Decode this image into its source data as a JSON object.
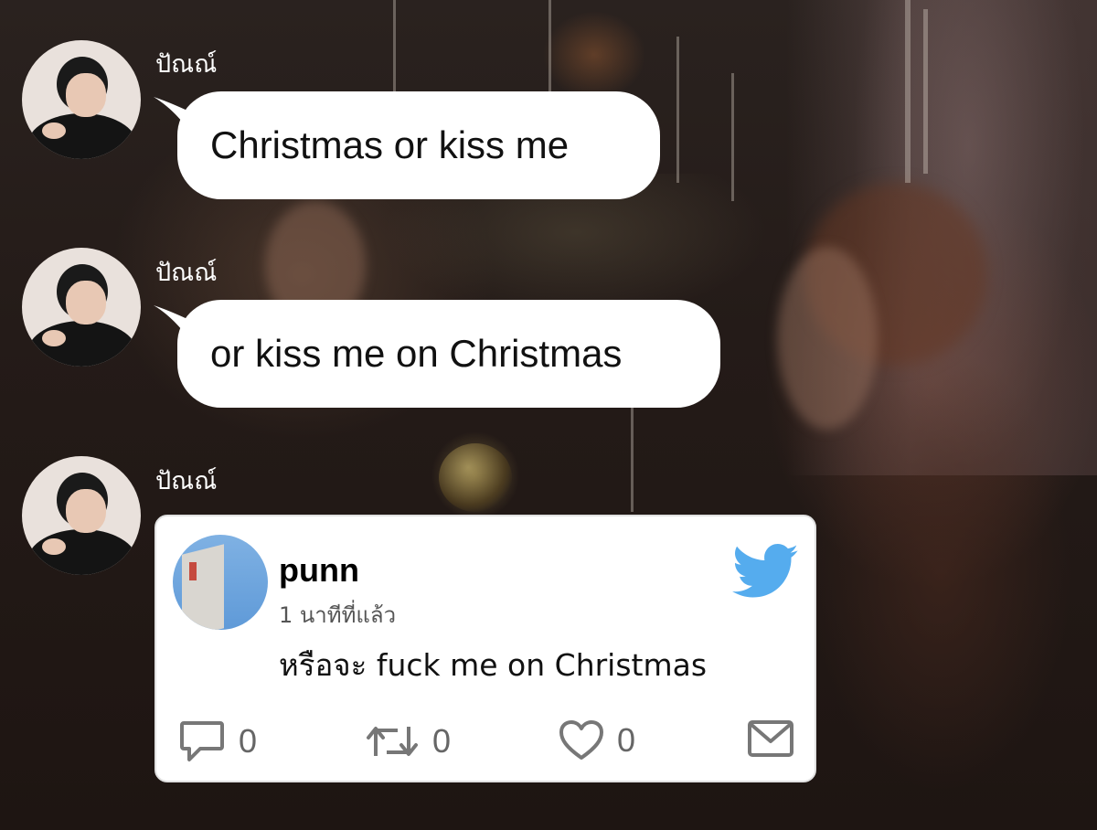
{
  "messages": [
    {
      "sender": "ปัณณ์",
      "text": "Christmas or kiss me"
    },
    {
      "sender": "ปัณณ์",
      "text": "or kiss me on Christmas"
    },
    {
      "sender": "ปัณณ์"
    }
  ],
  "tweet": {
    "username": "punn",
    "time": "1 นาทีที่แล้ว",
    "text": "หรือจะ fuck me on Christmas",
    "reply_count": "0",
    "retweet_count": "0",
    "like_count": "0",
    "icons": [
      "reply-icon",
      "retweet-icon",
      "heart-icon",
      "mail-icon",
      "twitter-bird-icon"
    ]
  },
  "colors": {
    "bubble": "#ffffff",
    "twitter_blue": "#55acee",
    "icon_gray": "#777777"
  }
}
